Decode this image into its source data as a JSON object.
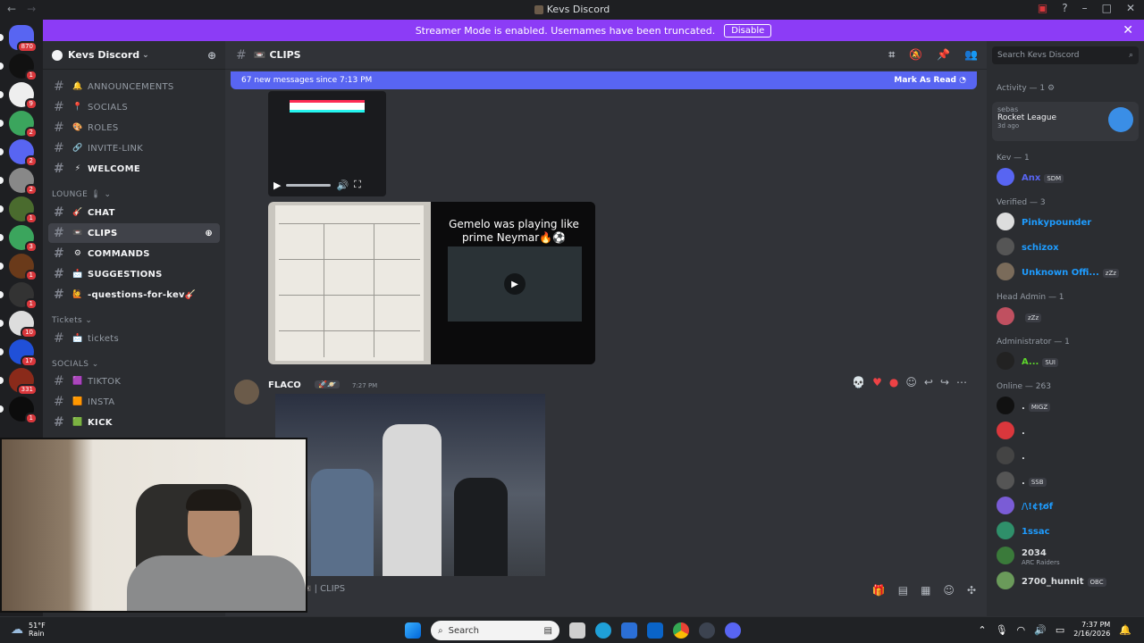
{
  "window": {
    "title": "Kevs Discord"
  },
  "banner": {
    "text": "Streamer Mode is enabled. Usernames have been truncated.",
    "button": "Disable"
  },
  "servers": [
    {
      "badge": "870"
    },
    {
      "badge": "1"
    },
    {
      "badge": "9"
    },
    {
      "badge": "2"
    },
    {
      "badge": "2"
    },
    {
      "badge": "2"
    },
    {
      "badge": "1"
    },
    {
      "badge": "3"
    },
    {
      "badge": "1"
    },
    {
      "badge": "1"
    },
    {
      "badge": "10"
    },
    {
      "badge": "17"
    },
    {
      "badge": "331"
    },
    {
      "badge": "1"
    }
  ],
  "sidebar": {
    "server_name": "Kevs Discord",
    "channels": [
      {
        "emoji": "🔔",
        "label": "ANNOUNCEMENTS"
      },
      {
        "emoji": "📍",
        "label": "SOCIALS"
      },
      {
        "emoji": "🎨",
        "label": "ROLES"
      },
      {
        "emoji": "🔗",
        "label": "INVITE-LINK"
      },
      {
        "emoji": "⚡",
        "label": "WELCOME"
      }
    ],
    "lounge_label": "LOUNGE 🌡",
    "lounge_channels": [
      {
        "emoji": "🎸",
        "label": "CHAT"
      },
      {
        "emoji": "📼",
        "label": "CLIPS"
      },
      {
        "emoji": "⚙",
        "label": "COMMANDS"
      },
      {
        "emoji": "📩",
        "label": "SUGGESTIONS"
      },
      {
        "emoji": "🙋",
        "label": "-questions-for-kev🎸"
      }
    ],
    "tickets_label": "Tickets",
    "tickets_channel": {
      "emoji": "📩",
      "label": "tickets"
    },
    "socials_label": "SOCIALS",
    "socials_channels": [
      {
        "emoji": "🟪",
        "label": "TIKTOK"
      },
      {
        "emoji": "🟧",
        "label": "INSTA"
      },
      {
        "emoji": "🟩",
        "label": "KICK"
      }
    ]
  },
  "channel": {
    "name": "CLIPS",
    "emoji": "📼"
  },
  "new_messages": {
    "text": "67 new messages since 7:13 PM",
    "action": "Mark As Read"
  },
  "attachment": {
    "caption": "Gemelo was playing like prime Neymar🔥⚽"
  },
  "message": {
    "author": "FLACO",
    "tag": "🚀🪐",
    "time": "7:27 PM"
  },
  "composer": {
    "placeholder": "📼 | CLIPS"
  },
  "members": {
    "search_placeholder": "Search Kevs Discord",
    "activity_label": "Activity — 1",
    "activity": {
      "user": "sebas",
      "game": "Rocket League",
      "ago": "3d ago"
    },
    "groups": [
      {
        "label": "Kev — 1",
        "members": [
          {
            "name": "Anx",
            "tag": "SDM",
            "color": "#5865f2"
          }
        ]
      },
      {
        "label": "Verified — 3",
        "members": [
          {
            "name": "Pinkypounder",
            "tag": "",
            "color": "#1e9cff"
          },
          {
            "name": "schizox",
            "tag": "",
            "color": "#1e9cff"
          },
          {
            "name": "Unknown Offi...",
            "tag": "zZz",
            "color": "#1e9cff"
          }
        ]
      },
      {
        "label": "Head Admin — 1",
        "members": [
          {
            "name": "",
            "tag": "zZz",
            "color": "#f2f3f5"
          }
        ]
      },
      {
        "label": "Administrator — 1",
        "members": [
          {
            "name": "A...",
            "tag": "SUI",
            "color": "#5dd62c"
          }
        ]
      },
      {
        "label": "Online — 263",
        "members": [
          {
            "name": ".",
            "tag": "MIGZ",
            "color": "#dbdee1"
          },
          {
            "name": ".",
            "tag": "",
            "color": "#dbdee1"
          },
          {
            "name": ".",
            "tag": "",
            "color": "#dbdee1"
          },
          {
            "name": ".",
            "tag": "SSB",
            "color": "#dbdee1"
          },
          {
            "name": "/\\!¢†o̸f",
            "tag": "",
            "color": "#1e9cff"
          },
          {
            "name": "1ssac",
            "tag": "",
            "color": "#1e9cff"
          },
          {
            "name": "2034",
            "tag": "",
            "color": "#dbdee1",
            "sub": "ARC Raiders"
          },
          {
            "name": "2700_hunnit",
            "tag": "OBC",
            "color": "#dbdee1"
          }
        ]
      }
    ]
  },
  "taskbar": {
    "weather_temp": "51°F",
    "weather_desc": "Rain",
    "search": "Search",
    "time": "7:37 PM",
    "date": "2/16/2026"
  }
}
